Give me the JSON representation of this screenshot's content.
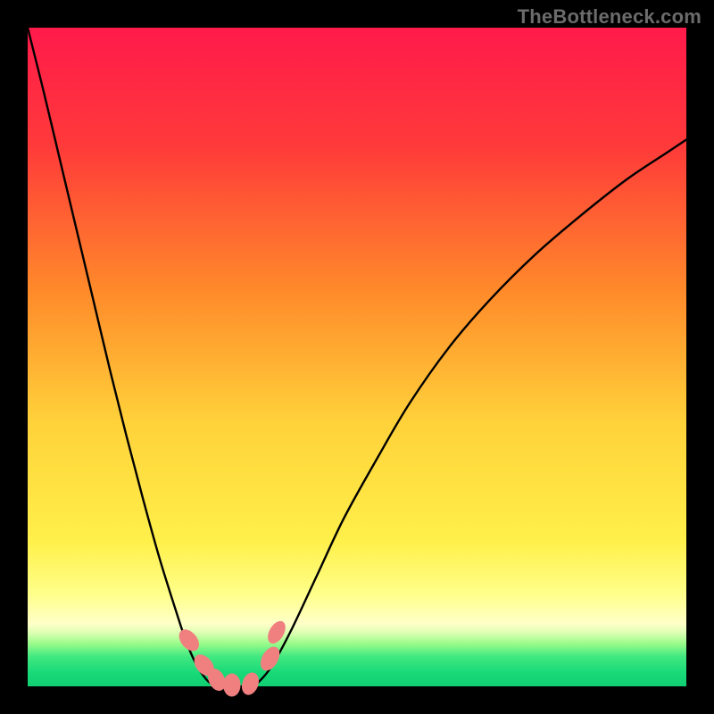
{
  "watermark": "TheBottleneck.com",
  "chart_data": {
    "type": "line",
    "title": "",
    "xlabel": "",
    "ylabel": "",
    "xlim": [
      0,
      100
    ],
    "ylim": [
      0,
      100
    ],
    "grid": false,
    "legend": false,
    "gradient_stops": [
      {
        "offset": 0.0,
        "color": "#ff1a4b"
      },
      {
        "offset": 0.18,
        "color": "#ff3a3a"
      },
      {
        "offset": 0.4,
        "color": "#ff8a2a"
      },
      {
        "offset": 0.6,
        "color": "#ffd23a"
      },
      {
        "offset": 0.78,
        "color": "#fff04a"
      },
      {
        "offset": 0.86,
        "color": "#ffff8a"
      },
      {
        "offset": 0.905,
        "color": "#ffffc8"
      },
      {
        "offset": 0.92,
        "color": "#d8ffb0"
      },
      {
        "offset": 0.935,
        "color": "#9afc8a"
      },
      {
        "offset": 0.955,
        "color": "#40e880"
      },
      {
        "offset": 0.98,
        "color": "#18d978"
      },
      {
        "offset": 1.0,
        "color": "#10cf72"
      }
    ],
    "series": [
      {
        "name": "left-arm",
        "x": [
          0.0,
          2.5,
          5.0,
          7.5,
          10.0,
          12.5,
          15.0,
          17.5,
          20.0,
          22.5,
          24.0,
          25.5,
          27.0,
          28.0
        ],
        "y": [
          100.0,
          90.0,
          79.5,
          69.0,
          58.5,
          48.0,
          38.0,
          28.5,
          19.5,
          11.5,
          7.0,
          3.5,
          1.2,
          0.3
        ]
      },
      {
        "name": "right-arm",
        "x": [
          35.0,
          37.0,
          40.0,
          44.0,
          48.0,
          53.0,
          58.0,
          64.0,
          70.0,
          77.0,
          84.0,
          91.0,
          97.0,
          100.0
        ],
        "y": [
          0.6,
          3.0,
          8.5,
          17.0,
          25.5,
          34.5,
          43.0,
          51.5,
          58.5,
          65.5,
          71.5,
          77.0,
          81.0,
          83.0
        ]
      },
      {
        "name": "trough",
        "x": [
          28.0,
          29.0,
          30.0,
          31.0,
          32.0,
          33.0,
          34.0,
          35.0
        ],
        "y": [
          0.3,
          0.0,
          0.0,
          0.0,
          0.0,
          0.0,
          0.1,
          0.6
        ]
      }
    ],
    "markers": [
      {
        "x": 24.5,
        "y": 7.0,
        "rx": 2.2,
        "ry": 3.4,
        "rot": -40
      },
      {
        "x": 26.8,
        "y": 3.2,
        "rx": 2.2,
        "ry": 3.4,
        "rot": -40
      },
      {
        "x": 28.7,
        "y": 1.0,
        "rx": 2.2,
        "ry": 3.2,
        "rot": -25
      },
      {
        "x": 31.0,
        "y": 0.2,
        "rx": 2.4,
        "ry": 3.2,
        "rot": 0
      },
      {
        "x": 33.8,
        "y": 0.4,
        "rx": 2.2,
        "ry": 3.2,
        "rot": 20
      },
      {
        "x": 36.8,
        "y": 4.2,
        "rx": 2.2,
        "ry": 3.6,
        "rot": 30
      },
      {
        "x": 37.8,
        "y": 8.2,
        "rx": 2.0,
        "ry": 3.4,
        "rot": 30
      }
    ],
    "marker_color": "#f08080"
  }
}
